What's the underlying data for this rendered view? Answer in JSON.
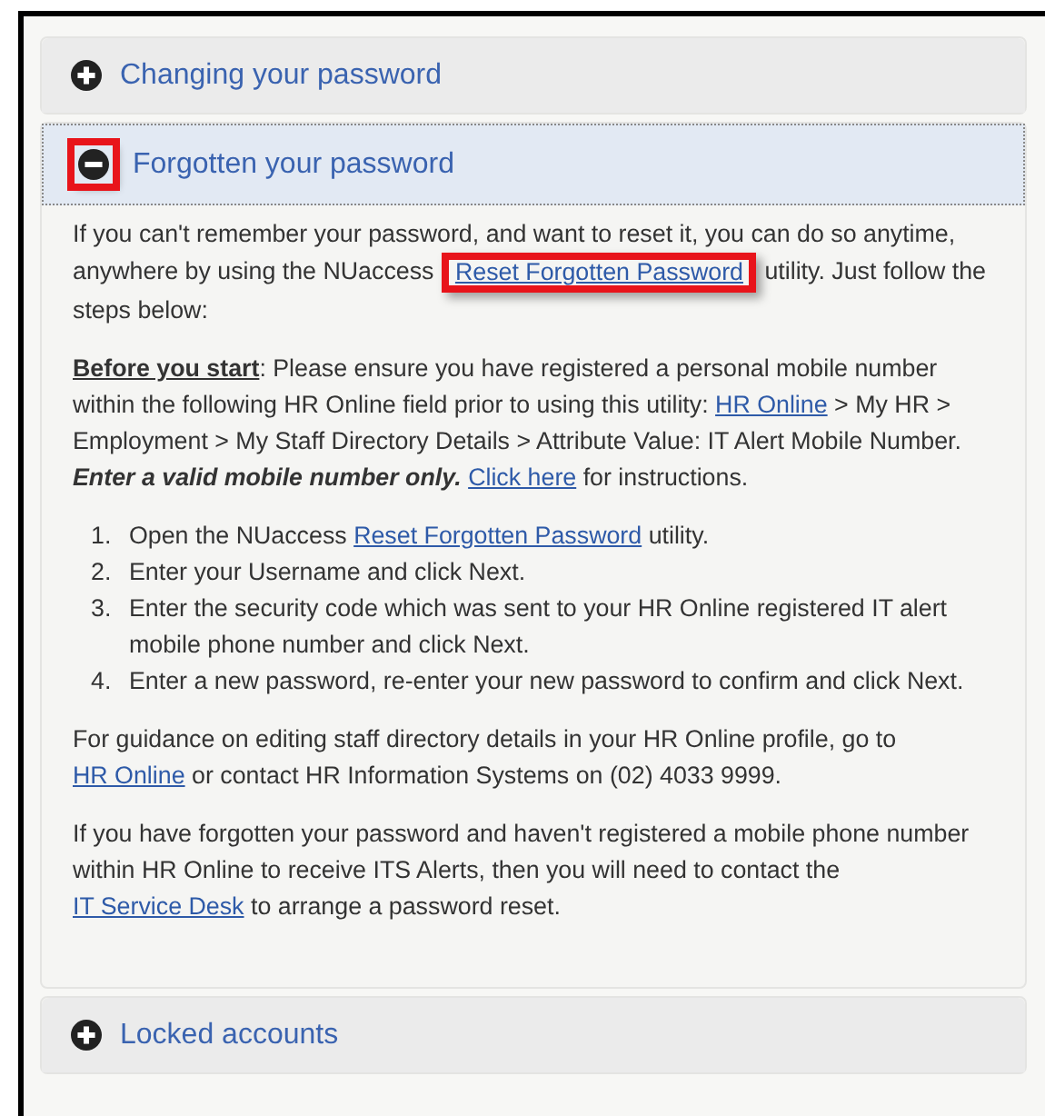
{
  "accordion": [
    {
      "title": "Changing your password",
      "expanded": false,
      "icon_highlighted": false
    },
    {
      "title": "Forgotten your password",
      "expanded": true,
      "icon_highlighted": true,
      "body": [
        {
          "kind": "paragraph",
          "segments": [
            {
              "kind": "text",
              "text": "If you can't remember your password, and want to reset it, you can do so anytime, anywhere by using the NUaccess "
            },
            {
              "kind": "link",
              "text": "Reset Forgotten Password",
              "highlighted": true
            },
            {
              "kind": "text",
              "text": " utility. Just follow the steps below:"
            }
          ]
        },
        {
          "kind": "paragraph",
          "segments": [
            {
              "kind": "lead",
              "text": "Before you start"
            },
            {
              "kind": "text",
              "text": ": Please ensure you have registered a personal mobile number within the following HR Online field prior to using this utility: "
            },
            {
              "kind": "link",
              "text": "HR Online",
              "highlighted": false
            },
            {
              "kind": "text",
              "text": " > My HR > Employment > My Staff Directory Details > Attribute Value:  IT Alert Mobile Number. "
            },
            {
              "kind": "emphasis",
              "text": "Enter a valid mobile number only."
            },
            {
              "kind": "link",
              "text": "Click here",
              "highlighted": false
            },
            {
              "kind": "text",
              "text": " for instructions."
            }
          ]
        },
        {
          "kind": "steps",
          "items": [
            {
              "marker": "1.",
              "segments": [
                {
                  "kind": "text",
                  "text": "Open the NUaccess "
                },
                {
                  "kind": "link",
                  "text": "Reset Forgotten Password",
                  "highlighted": false
                },
                {
                  "kind": "text",
                  "text": " utility."
                }
              ]
            },
            {
              "marker": "2.",
              "segments": [
                {
                  "kind": "text",
                  "text": "Enter your Username and click Next."
                }
              ]
            },
            {
              "marker": "3.",
              "segments": [
                {
                  "kind": "text",
                  "text": "Enter the security code which was sent to your HR Online registered IT alert mobile phone number and click Next."
                }
              ]
            },
            {
              "marker": "4.",
              "segments": [
                {
                  "kind": "text",
                  "text": "Enter a new password, re-enter your new password to confirm and click Next."
                }
              ]
            }
          ]
        },
        {
          "kind": "paragraph",
          "segments": [
            {
              "kind": "text",
              "text": "For guidance on editing staff directory details in your HR Online profile, go to "
            },
            {
              "kind": "link",
              "text": "HR Online",
              "highlighted": false
            },
            {
              "kind": "text",
              "text": " or contact HR Information Systems on (02) 4033 9999."
            }
          ]
        },
        {
          "kind": "paragraph",
          "segments": [
            {
              "kind": "text",
              "text": "If you have forgotten your password and haven't registered a mobile phone number within HR Online to receive ITS Alerts, then you will need to contact the "
            },
            {
              "kind": "link",
              "text": "IT Service Desk",
              "highlighted": false
            },
            {
              "kind": "text",
              "text": " to arrange a password reset."
            }
          ]
        }
      ]
    },
    {
      "title": "Locked accounts",
      "expanded": false,
      "icon_highlighted": false
    }
  ]
}
